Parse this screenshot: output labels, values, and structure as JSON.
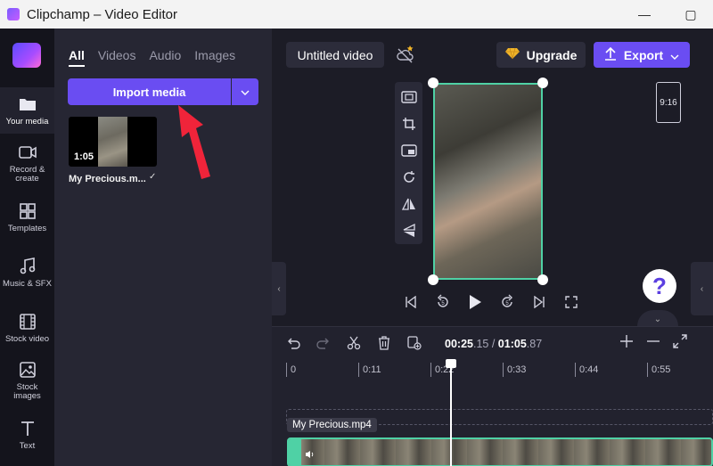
{
  "window": {
    "title": "Clipchamp – Video Editor",
    "minimize": "—",
    "maximize": "▢"
  },
  "rail": {
    "items": [
      {
        "label": "Your media",
        "icon": "folder-icon"
      },
      {
        "label": "Record & create",
        "icon": "camera-icon"
      },
      {
        "label": "Templates",
        "icon": "templates-icon"
      },
      {
        "label": "Music & SFX",
        "icon": "music-icon"
      },
      {
        "label": "Stock video",
        "icon": "film-icon"
      },
      {
        "label": "Stock images",
        "icon": "image-icon"
      },
      {
        "label": "Text",
        "icon": "text-icon"
      }
    ]
  },
  "media": {
    "tabs": [
      "All",
      "Videos",
      "Audio",
      "Images"
    ],
    "import_label": "Import media",
    "item": {
      "name": "My Precious.m...",
      "duration": "1:05"
    }
  },
  "editor": {
    "project_title": "Untitled video",
    "upgrade_label": "Upgrade",
    "export_label": "Export",
    "aspect_ratio": "9:16",
    "help_label": "?"
  },
  "timeline": {
    "current_time": "00:25",
    "current_frac": ".15",
    "separator": " / ",
    "total_time": "01:05",
    "total_frac": ".87",
    "ticks": [
      "0",
      "0:11",
      "0:22",
      "0:33",
      "0:44",
      "0:55"
    ],
    "clip_name": "My Precious.mp4"
  },
  "colors": {
    "accent": "#6a4df2",
    "selection": "#4fd1a5",
    "annotation_arrow": "#f0243a"
  }
}
